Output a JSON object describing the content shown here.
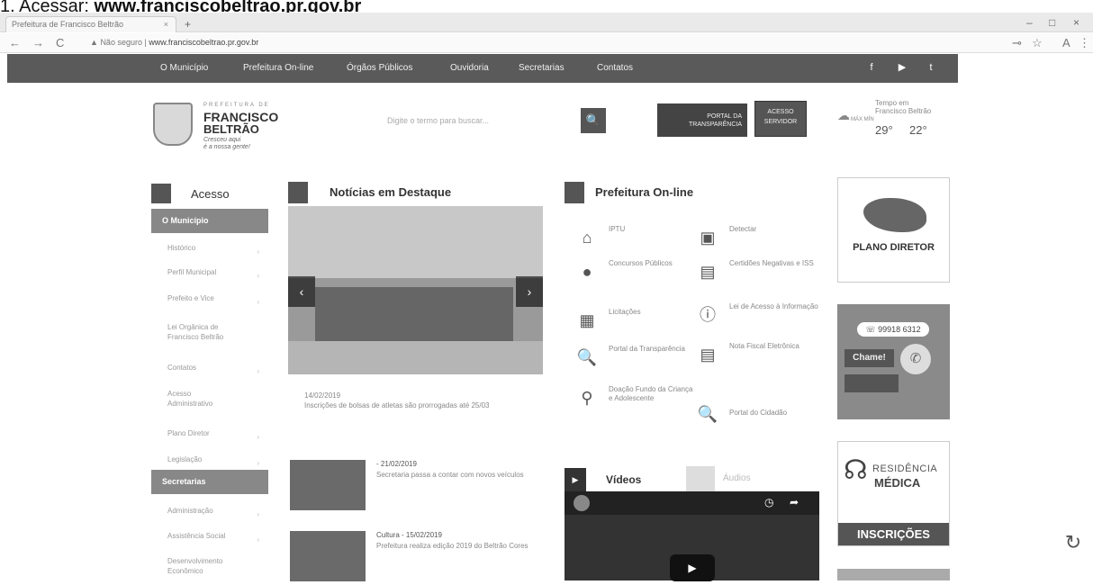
{
  "instruction": {
    "number": "1.",
    "text": "Acessar:",
    "url": "www.franciscobeltrao.pr.gov.br"
  },
  "browser": {
    "tab_title": "Prefeitura de Francisco Beltrão",
    "tab_close": "×",
    "new_tab": "+",
    "window_controls": [
      "–",
      "□",
      "×"
    ],
    "nav": {
      "back": "←",
      "forward": "→",
      "reload": "C"
    },
    "security": "Não seguro",
    "address": "www.franciscobeltrao.pr.gov.br",
    "icons": {
      "key": "⊸",
      "star": "☆",
      "menu": "⋮",
      "ext": "A"
    }
  },
  "topnav": {
    "items": [
      "O Município",
      "Prefeitura On-line",
      "Órgãos Públicos",
      "Ouvidoria",
      "Secretarias",
      "Contatos"
    ],
    "social": [
      "f",
      "▶",
      "t"
    ]
  },
  "logo": {
    "prefix": "PREFEITURA DE",
    "name1": "FRANCISCO",
    "name2": "BELTRÃO",
    "motto1": "Cresceu aqui",
    "motto2": "é a nossa gente!"
  },
  "search": {
    "placeholder": "Digite o termo para buscar...",
    "icon": "🔍"
  },
  "portal": {
    "line1": "PORTAL DA",
    "line2": "TRANSPARÊNCIA"
  },
  "acesso_servidor": {
    "line1": "ACESSO",
    "line2": "SERVIDOR"
  },
  "weather": {
    "label1": "Tempo em",
    "label2": "Francisco Beltrão",
    "unit": "MÁX MÍN",
    "max": "29°",
    "min": "22°",
    "icon": "☁"
  },
  "sidebar": {
    "title": "Acesso",
    "group1": "O Município",
    "items1": [
      "Histórico",
      "Perfil Municipal",
      "Prefeito e Vice",
      "Lei Orgânica de Francisco Beltrão",
      "Contatos",
      "Acesso Administrativo",
      "Plano Diretor",
      "Legislação"
    ],
    "group2": "Secretarias",
    "items2": [
      "Administração",
      "Assistência Social",
      "Desenvolvimento Econômico"
    ],
    "arrow": "›"
  },
  "news": {
    "title": "Notícias em Destaque",
    "prev": "‹",
    "next": "›",
    "main_date": "14/02/2019",
    "main_text": "Inscrições de bolsas de atletas são prorrogadas até 25/03",
    "items": [
      {
        "date": "- 21/02/2019",
        "text": "Secretaria passa a contar com novos veículos"
      },
      {
        "date": "Cultura - 15/02/2019",
        "text": "Prefeitura realiza edição 2019 do Beltrão Cores"
      }
    ]
  },
  "services": {
    "title": "Prefeitura On-line",
    "items": [
      {
        "icon": "⌂",
        "label": "IPTU"
      },
      {
        "icon": "▣",
        "label": "Detectar"
      },
      {
        "icon": "●",
        "label": "Concursos Públicos"
      },
      {
        "icon": "▤",
        "label": "Certidões Negativas e ISS"
      },
      {
        "icon": "▦",
        "label": "Licitações"
      },
      {
        "icon": "ⓘ",
        "label": "Lei de Acesso à Informação"
      },
      {
        "icon": "🔍",
        "label": "Portal da Transparência"
      },
      {
        "icon": "▤",
        "label": "Nota Fiscal Eletrônica"
      },
      {
        "icon": "⚲",
        "label": "Doação Fundo da Criança e Adolescente"
      },
      {
        "icon": "🔍",
        "label": "Portal do Cidadão"
      }
    ]
  },
  "videos": {
    "title": "Vídeos",
    "audios": "Áudios",
    "play": "▶",
    "clock": "◷",
    "share": "➦"
  },
  "banners": {
    "plano": "PLANO DIRETOR",
    "whats_phone": "☏ 99918 6312",
    "whats_cta": "Chame!",
    "whats_icon": "✆",
    "resid1": "RESIDÊNCIA",
    "resid2": "MÉDICA",
    "resid_cta": "INSCRIÇÕES",
    "steth": "☊"
  },
  "recaptcha_icon": "↻"
}
